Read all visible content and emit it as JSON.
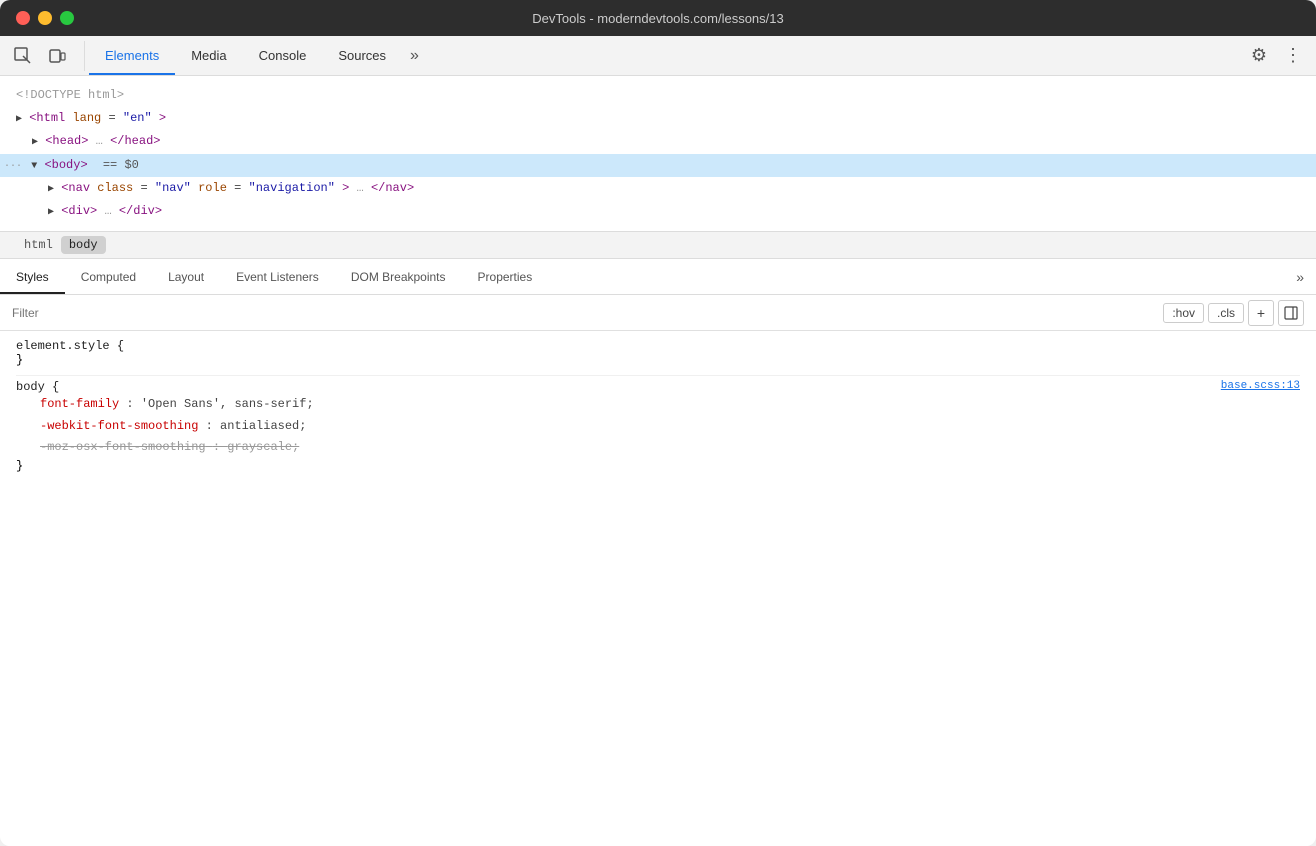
{
  "titlebar": {
    "title": "DevTools - moderndevtools.com/lessons/13"
  },
  "top_tabs": [
    {
      "id": "elements",
      "label": "Elements",
      "active": true
    },
    {
      "id": "media",
      "label": "Media",
      "active": false
    },
    {
      "id": "console",
      "label": "Console",
      "active": false
    },
    {
      "id": "sources",
      "label": "Sources",
      "active": false
    }
  ],
  "top_tabs_more": "»",
  "dom_lines": [
    {
      "id": "doctype",
      "content": "<!DOCTYPE html>",
      "indent": 0,
      "selected": false
    },
    {
      "id": "html",
      "content": "<html lang=\"en\">",
      "indent": 0,
      "selected": false
    },
    {
      "id": "head",
      "content": "<head>…</head>",
      "indent": 1,
      "selected": false
    },
    {
      "id": "body",
      "content": "<body> == $0",
      "indent": 0,
      "selected": true,
      "triangle": true,
      "dots": "..."
    },
    {
      "id": "nav",
      "content": "<nav class=\"nav\" role=\"navigation\">…</nav>",
      "indent": 2,
      "selected": false
    },
    {
      "id": "div",
      "content": "<div>…</div>",
      "indent": 2,
      "selected": false
    }
  ],
  "breadcrumbs": [
    {
      "id": "html-bc",
      "label": "html",
      "active": false
    },
    {
      "id": "body-bc",
      "label": "body",
      "active": true
    }
  ],
  "sub_tabs": [
    {
      "id": "styles",
      "label": "Styles",
      "active": true
    },
    {
      "id": "computed",
      "label": "Computed",
      "active": false
    },
    {
      "id": "layout",
      "label": "Layout",
      "active": false
    },
    {
      "id": "event-listeners",
      "label": "Event Listeners",
      "active": false
    },
    {
      "id": "dom-breakpoints",
      "label": "DOM Breakpoints",
      "active": false
    },
    {
      "id": "properties",
      "label": "Properties",
      "active": false
    }
  ],
  "sub_tabs_more": "»",
  "filter": {
    "placeholder": "Filter",
    "hov_label": ":hov",
    "cls_label": ".cls"
  },
  "styles_content": {
    "element_style_selector": "element.style {",
    "element_style_close": "}",
    "body_selector": "body {",
    "body_close": "}",
    "body_source": "base.scss:13",
    "body_props": [
      {
        "id": "font-family",
        "prop": "font-family",
        "value": "'Open Sans', sans-serif;",
        "strikethrough": false
      },
      {
        "id": "webkit-font-smoothing",
        "prop": "-webkit-font-smoothing",
        "value": "antialiased;",
        "strikethrough": false
      },
      {
        "id": "moz-font-smoothing",
        "prop": "-moz-osx-font-smoothing",
        "value": "grayscale;",
        "strikethrough": true
      }
    ]
  },
  "icons": {
    "inspector": "⬚",
    "device": "⬛",
    "more_vert": "⋮",
    "settings": "⚙",
    "chevron_right": "»",
    "triangle_right": "▶",
    "triangle_down": "▼",
    "plus": "+",
    "sidebar": "◫"
  },
  "colors": {
    "active_tab_underline": "#1a73e8",
    "selected_row_bg": "#cce8fb",
    "tag_color": "#881280",
    "attr_name_color": "#994500",
    "attr_value_color": "#1a1aa6",
    "prop_color": "#c80000",
    "source_link_color": "#1a73e8"
  }
}
